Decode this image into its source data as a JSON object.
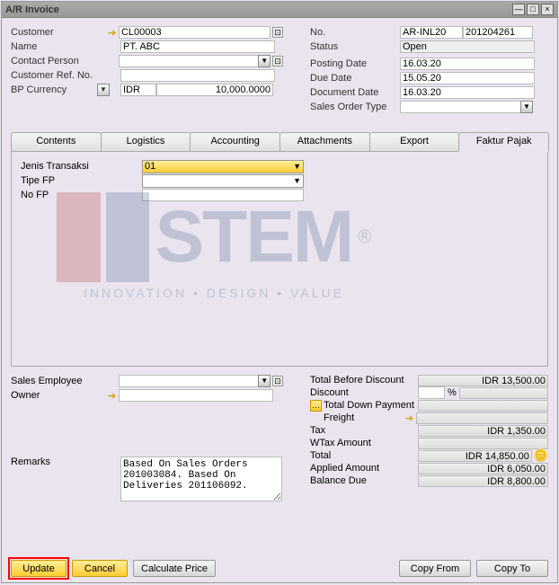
{
  "window": {
    "title": "A/R Invoice"
  },
  "header": {
    "left": {
      "customer_label": "Customer",
      "customer": "CL00003",
      "name_label": "Name",
      "name": "PT. ABC",
      "contact_label": "Contact Person",
      "contact": "",
      "custref_label": "Customer Ref. No.",
      "custref": "",
      "bpcur_label": "BP Currency",
      "bpcur": "IDR",
      "rate": "10,000.0000"
    },
    "right": {
      "no_label": "No.",
      "no_series": "AR-INL20",
      "no_val": "201204261",
      "status_label": "Status",
      "status": "Open",
      "posting_label": "Posting Date",
      "posting": "16.03.20",
      "due_label": "Due Date",
      "due": "15.05.20",
      "doc_label": "Document Date",
      "doc": "16.03.20",
      "sot_label": "Sales Order Type",
      "sot": ""
    }
  },
  "tabs": [
    "Contents",
    "Logistics",
    "Accounting",
    "Attachments",
    "Export",
    "Faktur Pajak"
  ],
  "fp": {
    "jenis_label": "Jenis Transaksi",
    "jenis": "01",
    "tipe_label": "Tipe FP",
    "tipe": "",
    "nofp_label": "No FP",
    "nofp": ""
  },
  "below": {
    "sales_emp_label": "Sales Employee",
    "sales_emp": "",
    "owner_label": "Owner",
    "owner": "",
    "remarks_label": "Remarks",
    "remarks": "Based On Sales Orders 201003084. Based On Deliveries 201106092."
  },
  "totals": {
    "tbd_label": "Total Before Discount",
    "tbd": "IDR 13,500.00",
    "disc_label": "Discount",
    "disc_pct": "",
    "pct": "%",
    "disc_amt": "",
    "tdp_label": "Total Down Payment",
    "tdp": "",
    "freight_label": "Freight",
    "freight": "",
    "tax_label": "Tax",
    "tax": "IDR 1,350.00",
    "wtax_label": "WTax Amount",
    "wtax": "",
    "total_label": "Total",
    "total": "IDR 14,850.00",
    "applied_label": "Applied Amount",
    "applied": "IDR 6,050.00",
    "balance_label": "Balance Due",
    "balance": "IDR 8,800.00"
  },
  "buttons": {
    "update": "Update",
    "cancel": "Cancel",
    "calc": "Calculate Price",
    "copyfrom": "Copy From",
    "copyto": "Copy To"
  },
  "watermark": {
    "text": "STEM",
    "tag": "INNOVATION • DESIGN • VALUE"
  }
}
